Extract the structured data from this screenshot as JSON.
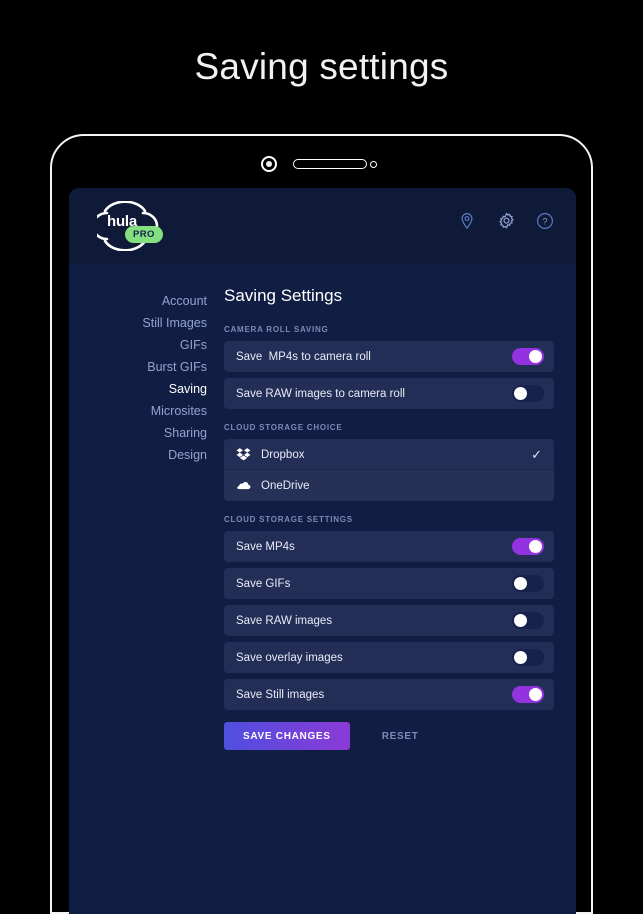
{
  "page": {
    "title": "Saving settings"
  },
  "device": {
    "camera_icon": "camera-icon",
    "speaker_icon": "speaker-slot-icon",
    "sensor_icon": "sensor-dot-icon"
  },
  "app": {
    "logo": {
      "word": "hula",
      "badge": "PRO",
      "badge_color": "#84e07f"
    },
    "header_icons": [
      {
        "name": "location-pin-icon",
        "label": "Location"
      },
      {
        "name": "gear-icon",
        "label": "Settings"
      },
      {
        "name": "help-icon",
        "label": "Help"
      }
    ]
  },
  "sidebar": {
    "items": [
      {
        "label": "Account",
        "active": false
      },
      {
        "label": "Still Images",
        "active": false
      },
      {
        "label": "GIFs",
        "active": false
      },
      {
        "label": "Burst GIFs",
        "active": false
      },
      {
        "label": "Saving",
        "active": true
      },
      {
        "label": "Microsites",
        "active": false
      },
      {
        "label": "Sharing",
        "active": false
      },
      {
        "label": "Design",
        "active": false
      }
    ]
  },
  "main": {
    "title": "Saving Settings",
    "sections": {
      "camera_roll": {
        "label": "CAMERA ROLL SAVING",
        "rows": [
          {
            "label": "Save  MP4s to camera roll",
            "state": "on"
          },
          {
            "label": "Save RAW images to camera roll",
            "state": "off"
          }
        ]
      },
      "cloud_choice": {
        "label": "CLOUD STORAGE CHOICE",
        "options": [
          {
            "label": "Dropbox",
            "icon": "dropbox-icon",
            "selected": true,
            "check": "✓"
          },
          {
            "label": "OneDrive",
            "icon": "onedrive-icon",
            "selected": false,
            "check": ""
          }
        ]
      },
      "cloud_settings": {
        "label": "CLOUD STORAGE SETTINGS",
        "rows": [
          {
            "label": "Save MP4s",
            "state": "on"
          },
          {
            "label": "Save GIFs",
            "state": "off"
          },
          {
            "label": "Save RAW images",
            "state": "off"
          },
          {
            "label": "Save overlay images",
            "state": "off"
          },
          {
            "label": "Save Still images",
            "state": "on"
          }
        ]
      }
    },
    "actions": {
      "save_label": "SAVE CHANGES",
      "reset_label": "RESET"
    }
  },
  "colors": {
    "accent_purple": "#9333e0",
    "screen_bg": "#111e43",
    "row_bg": "#232e57",
    "muted_text": "#7b8ab6"
  }
}
